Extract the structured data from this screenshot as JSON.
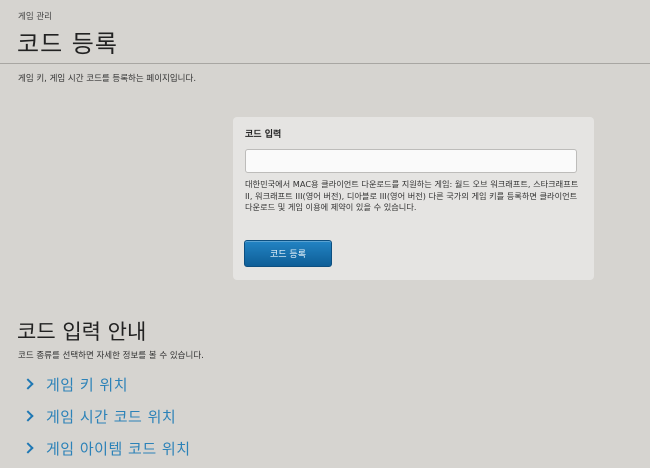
{
  "header": {
    "breadcrumb": "게임 관리",
    "title": "코드 등록",
    "description": "게임 키, 게임 시간 코드를 등록하는 페이지입니다."
  },
  "code_form": {
    "label": "코드 입력",
    "input_value": "",
    "note": "대한민국에서 MAC용 클라이언트 다운로드를 지원하는 게임: 월드 오브 워크래프트, 스타크래프트 II, 워크래프트 III(영어 버전), 디아블로 III(영어 버전) 다른 국가의 게임 키를 등록하면 클라이언트 다운로드 및 게임 이용에 제약이 있을 수 있습니다.",
    "submit_label": "코드 등록"
  },
  "guide": {
    "title": "코드 입력 안내",
    "description": "코드 종류를 선택하면 자세한 정보를 볼 수 있습니다.",
    "items": [
      {
        "label": "게임 키 위치"
      },
      {
        "label": "게임 시간 코드 위치"
      },
      {
        "label": "게임 아이템 코드 위치"
      }
    ]
  },
  "colors": {
    "page_background": "#d6d4d0",
    "panel_background": "#e5e4e2",
    "accent_blue": "#2c82b8",
    "button_blue": "#0e5e97"
  }
}
